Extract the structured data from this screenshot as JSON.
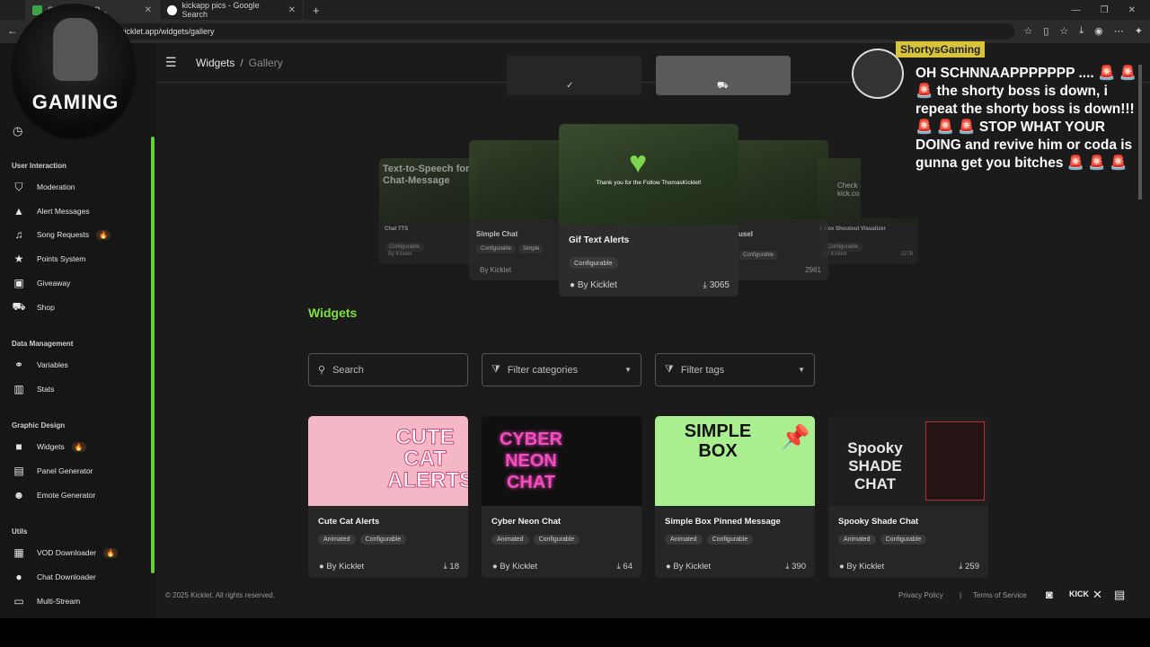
{
  "browser": {
    "tabs": [
      {
        "label": "Chatbot and O..."
      },
      {
        "label": "kickapp pics - Google Search"
      }
    ],
    "url": "kicklet.app/widgets/gallery"
  },
  "breadcrumb": {
    "root": "Widgets",
    "sep": "/",
    "current": "Gallery"
  },
  "sidebar": {
    "sections": [
      {
        "title": "User Interaction",
        "items": [
          {
            "label": "Moderation",
            "icon": "shield-icon"
          },
          {
            "label": "Alert Messages",
            "icon": "warning-icon"
          },
          {
            "label": "Song Requests",
            "icon": "music-icon",
            "badge": "🔥"
          },
          {
            "label": "Points System",
            "icon": "star-icon"
          },
          {
            "label": "Giveaway",
            "icon": "gift-icon"
          },
          {
            "label": "Shop",
            "icon": "cart-icon"
          }
        ]
      },
      {
        "title": "Data Management",
        "items": [
          {
            "label": "Variables",
            "icon": "link-icon"
          },
          {
            "label": "Stats",
            "icon": "bar-chart-icon"
          }
        ]
      },
      {
        "title": "Graphic Design",
        "items": [
          {
            "label": "Widgets",
            "icon": "video-icon",
            "badge": "🔥"
          },
          {
            "label": "Panel Generator",
            "icon": "panel-icon"
          },
          {
            "label": "Emote Generator",
            "icon": "emote-icon"
          }
        ]
      },
      {
        "title": "Utils",
        "items": [
          {
            "label": "VOD Downloader",
            "icon": "film-icon",
            "badge": "🔥"
          },
          {
            "label": "Chat Downloader",
            "icon": "chat-icon"
          },
          {
            "label": "Multi-Stream",
            "icon": "monitor-icon"
          }
        ]
      }
    ]
  },
  "carousel": {
    "center": {
      "title": "Gif Text Alerts",
      "tag": "Configurable",
      "author": "By Kicklet",
      "downloads": "3065",
      "thumb_text": "Thank you for the Follow ThomasKicklet!"
    },
    "left1": {
      "title": "Simple Chat",
      "tags": [
        "Configurable",
        "Simple"
      ],
      "author": "By Kicklet"
    },
    "left2": {
      "title": "Chat TTS",
      "tag": "Configurable",
      "author": "By Kicklet",
      "thumb_text": "Text-to-Speech for Chat-Message"
    },
    "right1": {
      "title": "usel",
      "tag": "Configurable",
      "downloads": "2961"
    },
    "right2": {
      "title": "e Box Shoutout Visualizer",
      "tag": "Configurable",
      "author": "By Kicklet",
      "downloads": "2278",
      "thumb_text": "Check kick.co"
    }
  },
  "widgets_heading": "Widgets",
  "filters": {
    "search_placeholder": "Search",
    "categories": "Filter categories",
    "tags": "Filter tags"
  },
  "widgets": [
    {
      "name": "Cute Cat Alerts",
      "tags": [
        "Animated",
        "Configurable"
      ],
      "author": "By Kicklet",
      "downloads": "18",
      "thumb": "CUTE CAT ALERTS",
      "color": "#f3b7c6"
    },
    {
      "name": "Cyber Neon Chat",
      "tags": [
        "Animated",
        "Configurable"
      ],
      "author": "By Kicklet",
      "downloads": "64",
      "thumb": "CYBER NEON CHAT",
      "color": "#101010"
    },
    {
      "name": "Simple Box Pinned Message",
      "tags": [
        "Animated",
        "Configurable"
      ],
      "author": "By Kicklet",
      "downloads": "390",
      "thumb": "SIMPLE BOX",
      "color": "#a9ee8f"
    },
    {
      "name": "Spooky Shade Chat",
      "tags": [
        "Animated",
        "Configurable"
      ],
      "author": "By Kicklet",
      "downloads": "259",
      "thumb": "Spooky SHADE CHAT",
      "color": "#1f1f1f"
    }
  ],
  "footer": {
    "copyright": "© 2025 Kicklet. All rights reserved.",
    "privacy": "Privacy Policy",
    "sep": "|",
    "terms": "Terms of Service"
  },
  "overlay": {
    "logo_text": "GAMING",
    "chat_user": "ShortysGaming",
    "chat_message": "OH SCHNNAAPPPPPPP .... 🚨 🚨 🚨 the shorty boss is down, i repeat the shorty boss is down!!! 🚨 🚨 🚨 STOP WHAT YOUR DOING and revive him or coda is gunna get you bitches 🚨 🚨 🚨"
  }
}
